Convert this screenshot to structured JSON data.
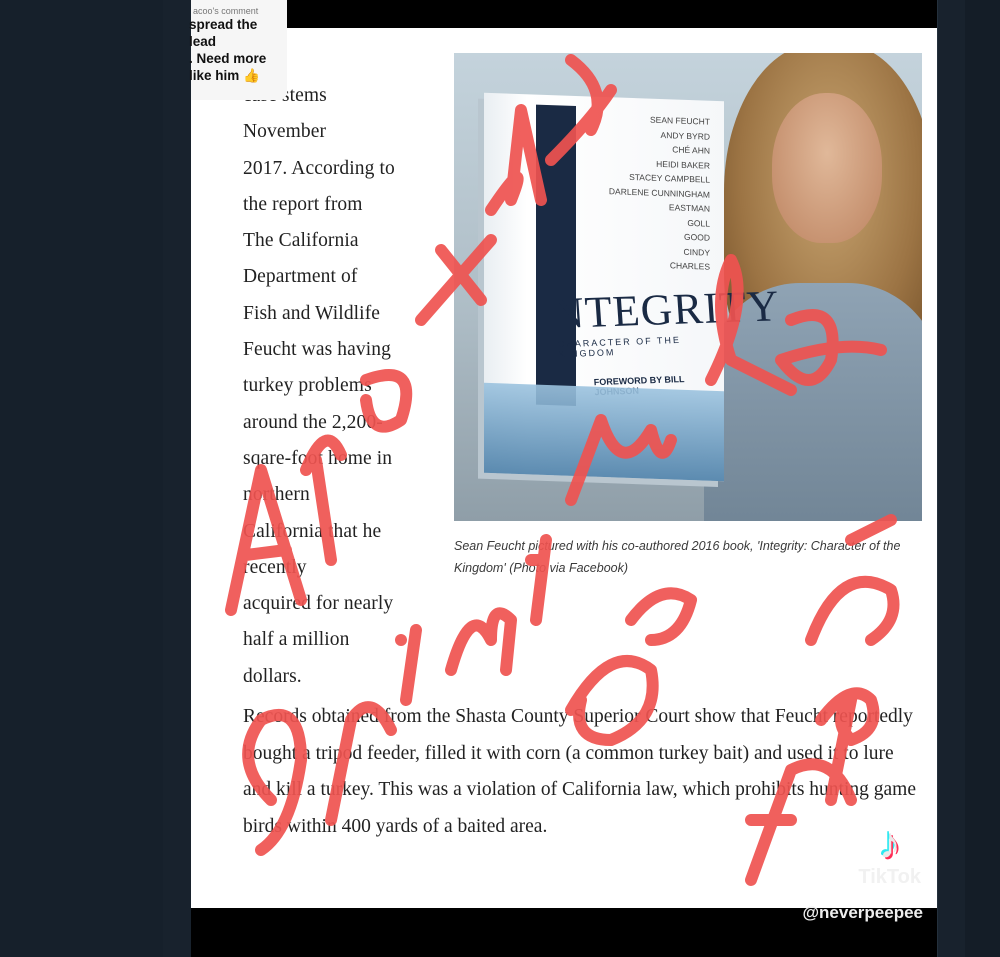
{
  "comment": {
    "header": "acoo's comment",
    "text": "spread the\nlead\n. Need more\nlike him 👍"
  },
  "article": {
    "para1": "case stems\nNovember\n2017. According to\nthe report from\nThe California\nDepartment of\nFish and Wildlife\nFeucht was having\nturkey problems\naround the 2,200-\nsqare-foot home in\nnorthern\nCalifornia that he\nrecently\nacquired for nearly\nhalf a million\ndollars.",
    "caption": "Sean Feucht pictured with his co-authored 2016 book, 'Integrity: Character of the Kingdom' (Photo via Facebook)",
    "para2": "Records obtained from the Shasta County Superior Court show that Feucht reportedly bought a tripod feeder, filled it with corn (a common turkey bait) and used it to lure and kill a turkey. This was a violation of California law, which prohibits hunting game birds within 400 yards of a baited area."
  },
  "book": {
    "title": "NTEGRITY",
    "subtitle": "CHARACTER OF THE KINGDOM",
    "foreword": "FOREWORD BY BILL JOHNSON",
    "authors": [
      "SEAN FEUCHT",
      "ANDY BYRD",
      "CHÉ AHN",
      "HEIDI BAKER",
      "STACEY CAMPBELL",
      "DARLENE CUNNINGHAM",
      "EASTMAN",
      "GOLL",
      "GOOD",
      "CINDY",
      "CHARLES"
    ]
  },
  "annotation": {
    "text": "Another criminal GOP figure",
    "color": "#ef5350"
  },
  "watermark": {
    "brand": "TikTok",
    "handle": "@neverpeepee"
  }
}
